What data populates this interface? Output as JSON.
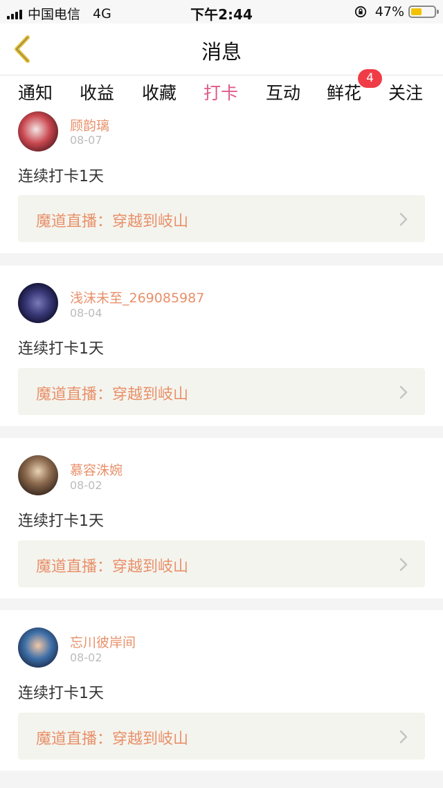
{
  "status_bar": {
    "carrier": "中国电信",
    "network": "4G",
    "time": "下午2:44",
    "battery": "47%",
    "battery_level": 0.47
  },
  "header": {
    "title": "消息"
  },
  "tabs": [
    {
      "label": "通知"
    },
    {
      "label": "收益"
    },
    {
      "label": "收藏"
    },
    {
      "label": "打卡",
      "active": true
    },
    {
      "label": "互动"
    },
    {
      "label": "鲜花",
      "badge": "4"
    },
    {
      "label": "关注"
    }
  ],
  "items": [
    {
      "user": "顾韵璃",
      "date": "08-07",
      "text": "连续打卡1天",
      "link": "魔道直播：穿越到岐山"
    },
    {
      "user": "浅沫未至_269085987",
      "date": "08-04",
      "text": "连续打卡1天",
      "link": "魔道直播：穿越到岐山"
    },
    {
      "user": "慕容洙婉",
      "date": "08-02",
      "text": "连续打卡1天",
      "link": "魔道直播：穿越到岐山"
    },
    {
      "user": "忘川彼岸间",
      "date": "08-02",
      "text": "连续打卡1天",
      "link": "魔道直播：穿越到岐山"
    }
  ],
  "colors": {
    "accent": "#e2588a",
    "username": "#e8906a",
    "badge": "#f03c46",
    "link_bg": "#f4f4ee"
  }
}
